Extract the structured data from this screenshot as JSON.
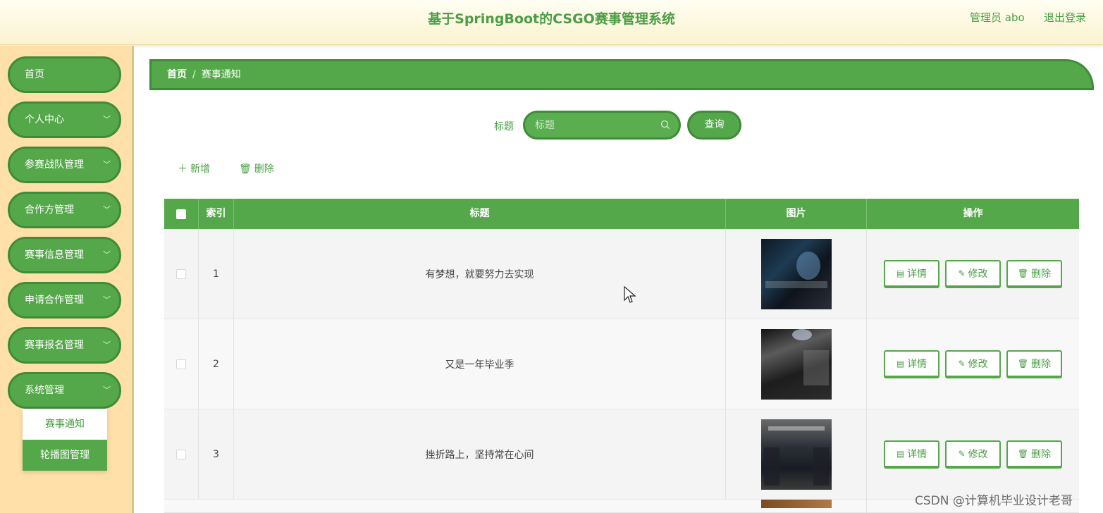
{
  "header": {
    "title": "基于SpringBoot的CSGO赛事管理系统",
    "user": "管理员 abo",
    "logout": "退出登录"
  },
  "sidebar": {
    "items": [
      {
        "label": "首页",
        "has_arrow": false
      },
      {
        "label": "个人中心",
        "has_arrow": true
      },
      {
        "label": "参赛战队管理",
        "has_arrow": true
      },
      {
        "label": "合作方管理",
        "has_arrow": true
      },
      {
        "label": "赛事信息管理",
        "has_arrow": true
      },
      {
        "label": "申请合作管理",
        "has_arrow": true
      },
      {
        "label": "赛事报名管理",
        "has_arrow": true
      },
      {
        "label": "系统管理",
        "has_arrow": true
      }
    ],
    "submenu": [
      {
        "label": "赛事通知",
        "active": true
      },
      {
        "label": "轮播图管理",
        "active": false
      }
    ]
  },
  "breadcrumb": {
    "home": "首页",
    "separator": "/",
    "current": "赛事通知"
  },
  "search": {
    "label": "标题",
    "placeholder": "标题",
    "button": "查询"
  },
  "toolbar": {
    "add": "新增",
    "delete": "删除"
  },
  "table": {
    "headers": [
      "索引",
      "标题",
      "图片",
      "操作"
    ],
    "rows": [
      {
        "index": "1",
        "title": "有梦想，就要努力去实现"
      },
      {
        "index": "2",
        "title": "又是一年毕业季"
      },
      {
        "index": "3",
        "title": "挫折路上，坚持常在心间"
      }
    ],
    "actions": {
      "detail": "详情",
      "edit": "修改",
      "delete": "删除"
    }
  },
  "watermark": "CSDN @计算机毕业设计老哥",
  "colors": {
    "primary": "#54a84a",
    "primary_dark": "#3f8b38",
    "header_bg": "#fbf3cf",
    "sidebar_bg": "#ffe0a8",
    "text_green": "#4a9e45"
  }
}
